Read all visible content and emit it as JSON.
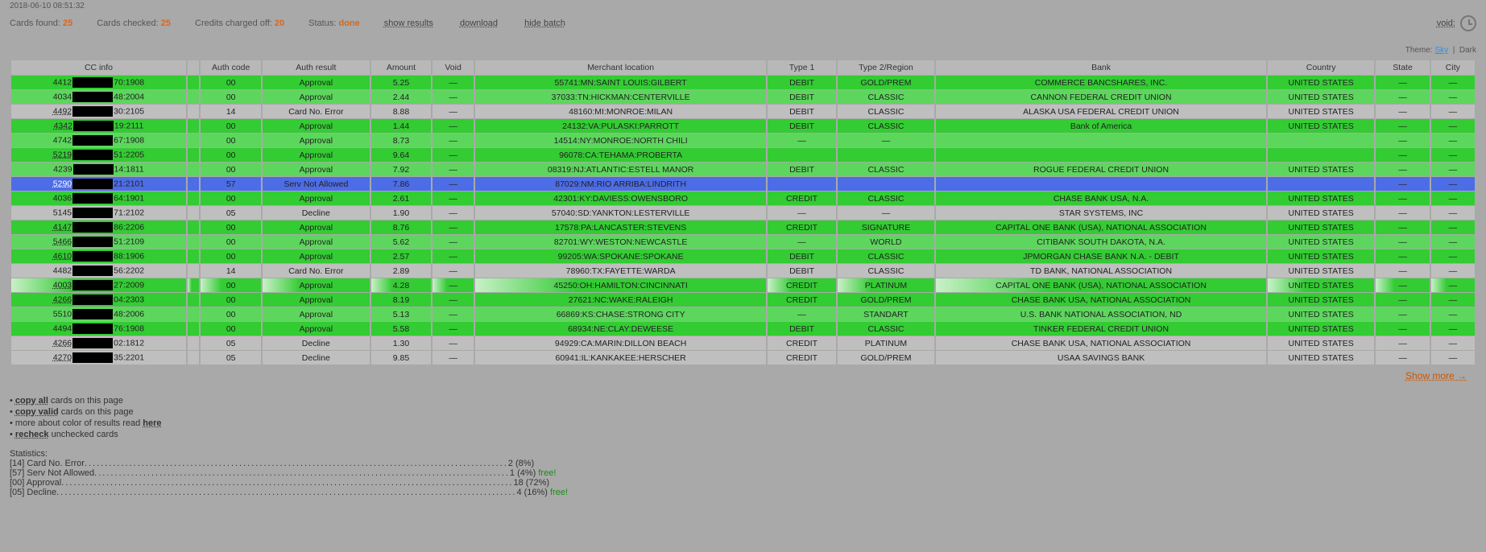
{
  "timestamp": "2018-06-10 08:51:32",
  "topbar": {
    "cards_found_label": "Cards found:",
    "cards_found": "25",
    "cards_checked_label": "Cards checked:",
    "cards_checked": "25",
    "credits_label": "Credits charged off:",
    "credits": "20",
    "status_label": "Status:",
    "status_value": "done",
    "show_results": "show results",
    "download": "download",
    "hide_batch": "hide batch",
    "void_label": "void:"
  },
  "theme": {
    "label": "Theme:",
    "sky": "Sky",
    "dark": "Dark"
  },
  "headers": [
    "CC info",
    "",
    "Auth code",
    "Auth result",
    "Amount",
    "Void",
    "Merchant location",
    "Type 1",
    "Type 2/Region",
    "Bank",
    "Country",
    "State",
    "City"
  ],
  "col_widths": [
    "180px",
    "12px",
    "62px",
    "110px",
    "62px",
    "42px",
    "300px",
    "70px",
    "100px",
    "340px",
    "110px",
    "55px",
    "45px"
  ],
  "rows": [
    {
      "cls": "row-green",
      "cc_prefix": "4412",
      "cc_suffix": "70:1908",
      "auth": "00",
      "result": "Approval",
      "amount": "5.25",
      "void": "—",
      "merchant": "55741:MN:SAINT LOUIS:GILBERT",
      "t1": "DEBIT",
      "t2": "GOLD/PREM",
      "bank": "COMMERCE BANCSHARES, INC.",
      "country": "UNITED STATES",
      "state": "—",
      "city": "—"
    },
    {
      "cls": "row-green-alt",
      "cc_prefix": "4034",
      "cc_suffix": "48:2004",
      "auth": "00",
      "result": "Approval",
      "amount": "2.44",
      "void": "—",
      "merchant": "37033:TN:HICKMAN:CENTERVILLE",
      "t1": "DEBIT",
      "t2": "CLASSIC",
      "bank": "CANNON FEDERAL CREDIT UNION",
      "country": "UNITED STATES",
      "state": "—",
      "city": "—"
    },
    {
      "cls": "row-gray",
      "cc_prefix": "4492",
      "cc_suffix": "30:2105",
      "auth": "14",
      "result": "Card No. Error",
      "amount": "8.88",
      "void": "—",
      "merchant": "48160:MI:MONROE:MILAN",
      "t1": "DEBIT",
      "t2": "CLASSIC",
      "bank": "ALASKA USA FEDERAL CREDIT UNION",
      "country": "UNITED STATES",
      "state": "—",
      "city": "—",
      "u": true
    },
    {
      "cls": "row-green",
      "cc_prefix": "4342",
      "cc_suffix": "19:2111",
      "auth": "00",
      "result": "Approval",
      "amount": "1.44",
      "void": "—",
      "merchant": "24132:VA:PULASKI:PARROTT",
      "t1": "DEBIT",
      "t2": "CLASSIC",
      "bank": "Bank of America",
      "country": "UNITED STATES",
      "state": "—",
      "city": "—",
      "u": true
    },
    {
      "cls": "row-green-alt",
      "cc_prefix": "4742",
      "cc_suffix": "67:1908",
      "auth": "00",
      "result": "Approval",
      "amount": "8.73",
      "void": "—",
      "merchant": "14514:NY:MONROE:NORTH CHILI",
      "t1": "—",
      "t2": "—",
      "bank": "",
      "country": "",
      "state": "—",
      "city": "—"
    },
    {
      "cls": "row-green",
      "cc_prefix": "5219",
      "cc_suffix": "51:2205",
      "auth": "00",
      "result": "Approval",
      "amount": "9.64",
      "void": "—",
      "merchant": "96078:CA:TEHAMA:PROBERTA",
      "t1": "",
      "t2": "",
      "bank": "",
      "country": "",
      "state": "—",
      "city": "—",
      "u": true
    },
    {
      "cls": "row-green-alt",
      "cc_prefix": "4239",
      "cc_suffix": "14:1811",
      "auth": "00",
      "result": "Approval",
      "amount": "7.92",
      "void": "—",
      "merchant": "08319:NJ:ATLANTIC:ESTELL MANOR",
      "t1": "DEBIT",
      "t2": "CLASSIC",
      "bank": "ROGUE FEDERAL CREDIT UNION",
      "country": "UNITED STATES",
      "state": "—",
      "city": "—"
    },
    {
      "cls": "row-blue",
      "cc_prefix": "5290",
      "cc_suffix": "21:2101",
      "auth": "57",
      "result": "Serv Not Allowed",
      "amount": "7.86",
      "void": "—",
      "merchant": "87029:NM:RIO ARRIBA:LINDRITH",
      "t1": "",
      "t2": "",
      "bank": "",
      "country": "",
      "state": "—",
      "city": "—",
      "u": true
    },
    {
      "cls": "row-green",
      "cc_prefix": "4036",
      "cc_suffix": "64:1901",
      "auth": "00",
      "result": "Approval",
      "amount": "2.61",
      "void": "—",
      "merchant": "42301:KY:DAVIESS:OWENSBORO",
      "t1": "CREDIT",
      "t2": "CLASSIC",
      "bank": "CHASE BANK USA, N.A.",
      "country": "UNITED STATES",
      "state": "—",
      "city": "—"
    },
    {
      "cls": "row-gray",
      "cc_prefix": "5145",
      "cc_suffix": "71:2102",
      "auth": "05",
      "result": "Decline",
      "amount": "1.90",
      "void": "—",
      "merchant": "57040:SD:YANKTON:LESTERVILLE",
      "t1": "—",
      "t2": "—",
      "bank": "STAR SYSTEMS, INC",
      "country": "UNITED STATES",
      "state": "—",
      "city": "—"
    },
    {
      "cls": "row-green",
      "cc_prefix": "4147",
      "cc_suffix": "86:2206",
      "auth": "00",
      "result": "Approval",
      "amount": "8.76",
      "void": "—",
      "merchant": "17578:PA:LANCASTER:STEVENS",
      "t1": "CREDIT",
      "t2": "SIGNATURE",
      "bank": "CAPITAL ONE BANK (USA), NATIONAL ASSOCIATION",
      "country": "UNITED STATES",
      "state": "—",
      "city": "—",
      "u": true
    },
    {
      "cls": "row-green-alt",
      "cc_prefix": "5466",
      "cc_suffix": "51:2109",
      "auth": "00",
      "result": "Approval",
      "amount": "5.62",
      "void": "—",
      "merchant": "82701:WY:WESTON:NEWCASTLE",
      "t1": "—",
      "t2": "WORLD",
      "bank": "CITIBANK SOUTH DAKOTA, N.A.",
      "country": "UNITED STATES",
      "state": "—",
      "city": "—",
      "u": true
    },
    {
      "cls": "row-green",
      "cc_prefix": "4610",
      "cc_suffix": "88:1906",
      "auth": "00",
      "result": "Approval",
      "amount": "2.57",
      "void": "—",
      "merchant": "99205:WA:SPOKANE:SPOKANE",
      "t1": "DEBIT",
      "t2": "CLASSIC",
      "bank": "JPMORGAN CHASE BANK N.A. - DEBIT",
      "country": "UNITED STATES",
      "state": "—",
      "city": "—",
      "u": true
    },
    {
      "cls": "row-gray",
      "cc_prefix": "4482",
      "cc_suffix": "56:2202",
      "auth": "14",
      "result": "Card No. Error",
      "amount": "2.89",
      "void": "—",
      "merchant": "78960:TX:FAYETTE:WARDA",
      "t1": "DEBIT",
      "t2": "CLASSIC",
      "bank": "TD BANK, NATIONAL ASSOCIATION",
      "country": "UNITED STATES",
      "state": "—",
      "city": "—"
    },
    {
      "cls": "row-fade",
      "cc_prefix": "4003",
      "cc_suffix": "27:2009",
      "auth": "00",
      "result": "Approval",
      "amount": "4.28",
      "void": "—",
      "merchant": "45250:OH:HAMILTON:CINCINNATI",
      "t1": "CREDIT",
      "t2": "PLATINUM",
      "bank": "CAPITAL ONE BANK (USA), NATIONAL ASSOCIATION",
      "country": "UNITED STATES",
      "state": "—",
      "city": "—",
      "u": true
    },
    {
      "cls": "row-green",
      "cc_prefix": "4266",
      "cc_suffix": "04:2303",
      "auth": "00",
      "result": "Approval",
      "amount": "8.19",
      "void": "—",
      "merchant": "27621:NC:WAKE:RALEIGH",
      "t1": "CREDIT",
      "t2": "GOLD/PREM",
      "bank": "CHASE BANK USA, NATIONAL ASSOCIATION",
      "country": "UNITED STATES",
      "state": "—",
      "city": "—",
      "u": true
    },
    {
      "cls": "row-green-alt",
      "cc_prefix": "5510",
      "cc_suffix": "48:2006",
      "auth": "00",
      "result": "Approval",
      "amount": "5.13",
      "void": "—",
      "merchant": "66869:KS:CHASE:STRONG CITY",
      "t1": "—",
      "t2": "STANDART",
      "bank": "U.S. BANK NATIONAL ASSOCIATION, ND",
      "country": "UNITED STATES",
      "state": "—",
      "city": "—"
    },
    {
      "cls": "row-green",
      "cc_prefix": "4494",
      "cc_suffix": "76:1908",
      "auth": "00",
      "result": "Approval",
      "amount": "5.58",
      "void": "—",
      "merchant": "68934:NE:CLAY:DEWEESE",
      "t1": "DEBIT",
      "t2": "CLASSIC",
      "bank": "TINKER FEDERAL CREDIT UNION",
      "country": "UNITED STATES",
      "state": "—",
      "city": "—"
    },
    {
      "cls": "row-gray",
      "cc_prefix": "4266",
      "cc_suffix": "02:1812",
      "auth": "05",
      "result": "Decline",
      "amount": "1.30",
      "void": "—",
      "merchant": "94929:CA:MARIN:DILLON BEACH",
      "t1": "CREDIT",
      "t2": "PLATINUM",
      "bank": "CHASE BANK USA, NATIONAL ASSOCIATION",
      "country": "UNITED STATES",
      "state": "—",
      "city": "—",
      "u": true
    },
    {
      "cls": "row-gray",
      "cc_prefix": "4270",
      "cc_suffix": "35:2201",
      "auth": "05",
      "result": "Decline",
      "amount": "9.85",
      "void": "—",
      "merchant": "60941:IL:KANKAKEE:HERSCHER",
      "t1": "CREDIT",
      "t2": "GOLD/PREM",
      "bank": "USAA SAVINGS BANK",
      "country": "UNITED STATES",
      "state": "—",
      "city": "—",
      "u": true
    }
  ],
  "show_more": "Show more →",
  "bottom": {
    "copy_all_b": "copy all",
    "copy_all_rest": " cards on this page",
    "copy_valid_b": "copy valid",
    "copy_valid_rest": " cards on this page",
    "more_pre": "more about color of results read ",
    "more_here": "here",
    "recheck_b": "recheck",
    "recheck_rest": " unchecked cards"
  },
  "stats": {
    "title": "Statistics:",
    "lines": [
      {
        "label": "[14] Card No. Error",
        "dots": "........................................................................................................",
        "value": "2 (8%)",
        "free": false
      },
      {
        "label": "[57] Serv Not Allowed",
        "dots": "......................................................................................................",
        "value": "1 (4%)",
        "free": true,
        "free_label": "free!"
      },
      {
        "label": "[00] Approval",
        "dots": "...............................................................................................................",
        "value": "18 (72%)",
        "free": false
      },
      {
        "label": "[05] Decline",
        "dots": ".................................................................................................................",
        "value": "4 (16%)",
        "free": true,
        "free_label": "free!"
      }
    ]
  }
}
